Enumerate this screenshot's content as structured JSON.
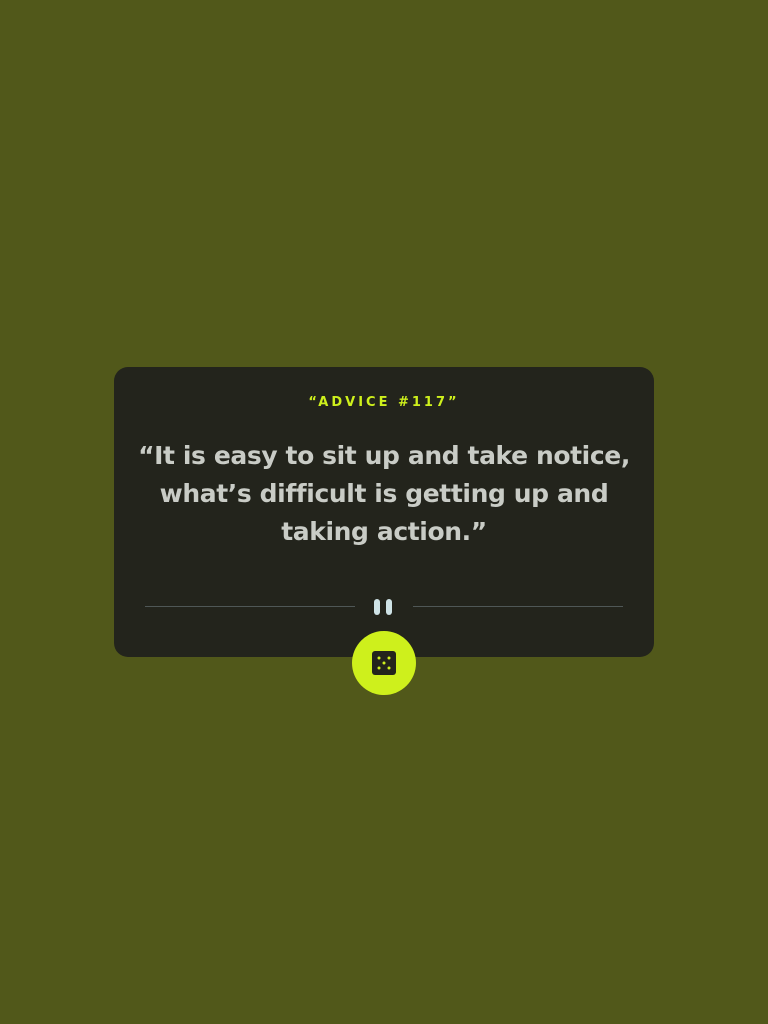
{
  "advice": {
    "id_label": "“ADVICE #117”",
    "text": "“It is easy to sit up and take notice, what’s difficult is getting up and taking action.”"
  },
  "icons": {
    "divider": "pause-icon",
    "generate": "dice-icon"
  },
  "colors": {
    "background": "#51581a",
    "card": "#23241c",
    "accent": "#cef01c",
    "quote_text": "#c9ccc6",
    "divider_line": "#4f5756"
  }
}
